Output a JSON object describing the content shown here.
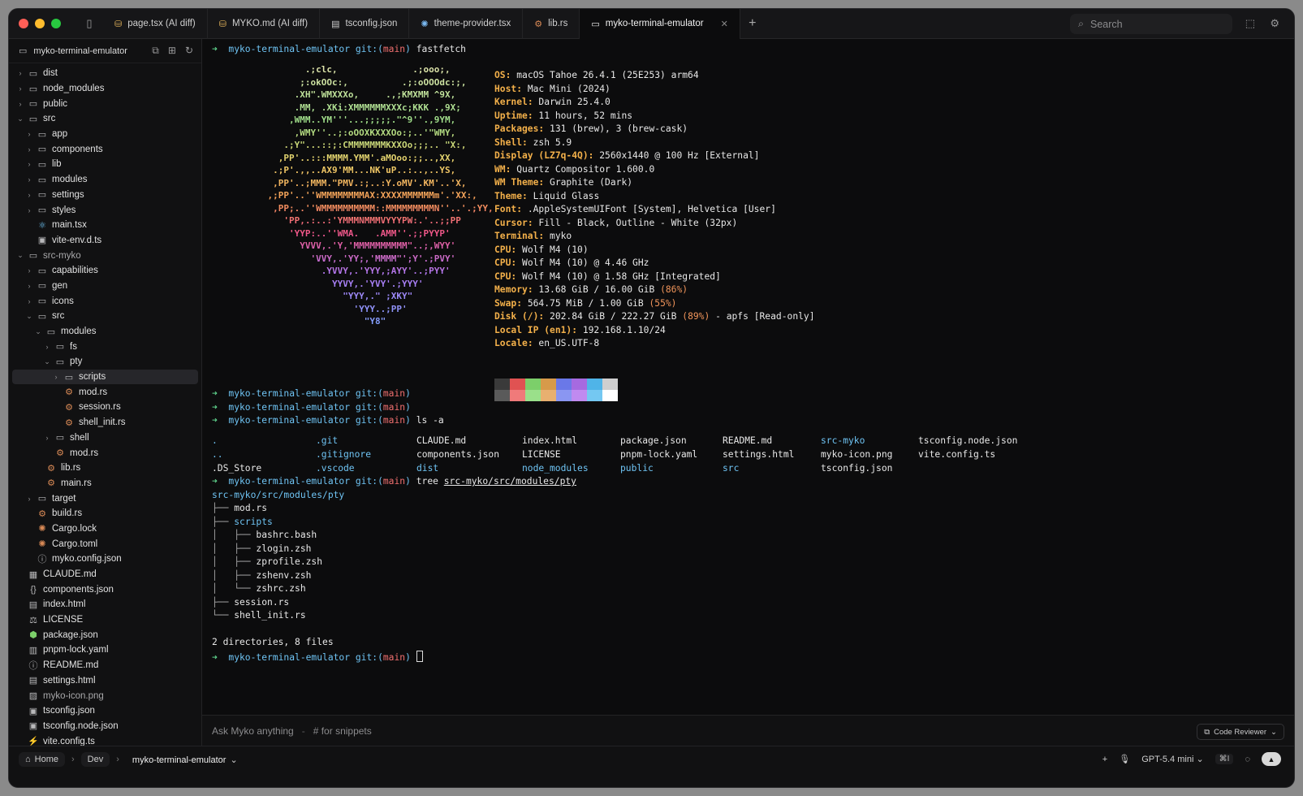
{
  "tabs": [
    {
      "label": "page.tsx (AI diff)",
      "icon": "folder-code-icon"
    },
    {
      "label": "MYKO.md (AI diff)",
      "icon": "folder-code-icon"
    },
    {
      "label": "tsconfig.json",
      "icon": "file-icon"
    },
    {
      "label": "theme-provider.tsx",
      "icon": "gear-icon"
    },
    {
      "label": "lib.rs",
      "icon": "rust-icon"
    },
    {
      "label": "myko-terminal-emulator",
      "icon": "folder-icon"
    }
  ],
  "search_label": "Search",
  "sidebar": {
    "project": "myko-terminal-emulator",
    "items": [
      {
        "label": "dist",
        "depth": 0,
        "chev": ">",
        "icon": "folder"
      },
      {
        "label": "node_modules",
        "depth": 0,
        "chev": ">",
        "icon": "folder"
      },
      {
        "label": "public",
        "depth": 0,
        "chev": ">",
        "icon": "folder"
      },
      {
        "label": "src",
        "depth": 0,
        "chev": "v",
        "icon": "folder"
      },
      {
        "label": "app",
        "depth": 1,
        "chev": ">",
        "icon": "folder"
      },
      {
        "label": "components",
        "depth": 1,
        "chev": ">",
        "icon": "folder"
      },
      {
        "label": "lib",
        "depth": 1,
        "chev": ">",
        "icon": "folder"
      },
      {
        "label": "modules",
        "depth": 1,
        "chev": ">",
        "icon": "folder"
      },
      {
        "label": "settings",
        "depth": 1,
        "chev": ">",
        "icon": "folder"
      },
      {
        "label": "styles",
        "depth": 1,
        "chev": ">",
        "icon": "folder"
      },
      {
        "label": "main.tsx",
        "depth": 1,
        "chev": "",
        "icon": "react"
      },
      {
        "label": "vite-env.d.ts",
        "depth": 1,
        "chev": "",
        "icon": "ts"
      },
      {
        "label": "src-myko",
        "depth": 0,
        "chev": "v",
        "icon": "folder",
        "dim": true
      },
      {
        "label": "capabilities",
        "depth": 1,
        "chev": ">",
        "icon": "folder"
      },
      {
        "label": "gen",
        "depth": 1,
        "chev": ">",
        "icon": "folder"
      },
      {
        "label": "icons",
        "depth": 1,
        "chev": ">",
        "icon": "folder"
      },
      {
        "label": "src",
        "depth": 1,
        "chev": "v",
        "icon": "folder"
      },
      {
        "label": "modules",
        "depth": 2,
        "chev": "v",
        "icon": "folder"
      },
      {
        "label": "fs",
        "depth": 3,
        "chev": ">",
        "icon": "folder"
      },
      {
        "label": "pty",
        "depth": 3,
        "chev": "v",
        "icon": "folder"
      },
      {
        "label": "scripts",
        "depth": 4,
        "chev": ">",
        "icon": "folder",
        "selected": true
      },
      {
        "label": "mod.rs",
        "depth": 4,
        "chev": "",
        "icon": "rust"
      },
      {
        "label": "session.rs",
        "depth": 4,
        "chev": "",
        "icon": "rust"
      },
      {
        "label": "shell_init.rs",
        "depth": 4,
        "chev": "",
        "icon": "rust"
      },
      {
        "label": "shell",
        "depth": 3,
        "chev": ">",
        "icon": "folder"
      },
      {
        "label": "mod.rs",
        "depth": 3,
        "chev": "",
        "icon": "rust"
      },
      {
        "label": "lib.rs",
        "depth": 2,
        "chev": "",
        "icon": "rust"
      },
      {
        "label": "main.rs",
        "depth": 2,
        "chev": "",
        "icon": "rust"
      },
      {
        "label": "target",
        "depth": 1,
        "chev": ">",
        "icon": "folder"
      },
      {
        "label": "build.rs",
        "depth": 1,
        "chev": "",
        "icon": "rust"
      },
      {
        "label": "Cargo.lock",
        "depth": 1,
        "chev": "",
        "icon": "gear"
      },
      {
        "label": "Cargo.toml",
        "depth": 1,
        "chev": "",
        "icon": "gear"
      },
      {
        "label": "myko.config.json",
        "depth": 1,
        "chev": "",
        "icon": "info"
      },
      {
        "label": "CLAUDE.md",
        "depth": 0,
        "chev": "",
        "icon": "md"
      },
      {
        "label": "components.json",
        "depth": 0,
        "chev": "",
        "icon": "braces"
      },
      {
        "label": "index.html",
        "depth": 0,
        "chev": "",
        "icon": "html"
      },
      {
        "label": "LICENSE",
        "depth": 0,
        "chev": "",
        "icon": "scale"
      },
      {
        "label": "package.json",
        "depth": 0,
        "chev": "",
        "icon": "pkg"
      },
      {
        "label": "pnpm-lock.yaml",
        "depth": 0,
        "chev": "",
        "icon": "yaml"
      },
      {
        "label": "README.md",
        "depth": 0,
        "chev": "",
        "icon": "info"
      },
      {
        "label": "settings.html",
        "depth": 0,
        "chev": "",
        "icon": "html"
      },
      {
        "label": "myko-icon.png",
        "depth": 0,
        "chev": "",
        "icon": "image",
        "dim": true
      },
      {
        "label": "tsconfig.json",
        "depth": 0,
        "chev": "",
        "icon": "ts"
      },
      {
        "label": "tsconfig.node.json",
        "depth": 0,
        "chev": "",
        "icon": "ts"
      },
      {
        "label": "vite.config.ts",
        "depth": 0,
        "chev": "",
        "icon": "vite"
      }
    ]
  },
  "terminal": {
    "prompt_dir": "myko-terminal-emulator",
    "prompt_git": "git:(",
    "prompt_branch": "main",
    "prompt_close": ")",
    "cmd1": "fastfetch",
    "logo": "           .;clc,              .;ooo;,\n          ;:okOOc:,          .;:oOOOdc:;,\n         .XH\".WMXXXo,     .,;KMXMM ^9X,\n         .MM, .XKi:XMMMMMMXXXc;KKK .,9X;\n        ,WMM..YM'''...;;;;;.\"^9''.,9YM,\n         ,WMY''..;:oOOXKXXXOo:;..'\"WMY,\n       .;Y\"...::;:CMMMMMMMKXXOo;;;.. \"X:,\n      ,PP'..:::MMMM.YMM'.aMOoo:;;..,XX,\n     .;P'.,,..AX9'MM...NK'uP..:..,..YS,\n     ,PP'..;MMM.\"PMV.:;..:Y.oMV'.KM'..'X,\n    ,;PP'..''WMMMMMMMMAX:XXXXMMMMMMm'.'XX:,\n     ,PP;..''WMMMMMMMMMM::MMMMMMMMMN''..'.;YY,\n       'PP,.:..:'YMMMNMMMVYYYPW:.'..;;PP\n        'YYP:..''WMA.   .AMM''.;;PYYP'\n          YVVV,.'Y,'MMMMMMMMMM\"..;,WYY'\n            'VVY,.'YY;,'MMMM\"';Y'.;PVY'\n              .YVVY,.'YYY,;AYY'..;PYY'\n                YYVY,.'YVY'.;YYY'\n                  \"YYY,.\" ;XKY\"\n                    'YYY..;PP'\n                      \"Y8\"",
    "info": [
      {
        "k": "OS",
        "v": "macOS Tahoe 26.4.1 (25E253) arm64"
      },
      {
        "k": "Host",
        "v": "Mac Mini (2024)"
      },
      {
        "k": "Kernel",
        "v": "Darwin 25.4.0"
      },
      {
        "k": "Uptime",
        "v": "11 hours, 52 mins"
      },
      {
        "k": "Packages",
        "v": "131 (brew), 3 (brew-cask)"
      },
      {
        "k": "Shell",
        "v": "zsh 5.9"
      },
      {
        "k": "Display (LZ7q-4Q)",
        "v": "2560x1440 @ 100 Hz [External]"
      },
      {
        "k": "WM",
        "v": "Quartz Compositor 1.600.0"
      },
      {
        "k": "WM Theme",
        "v": "Graphite (Dark)"
      },
      {
        "k": "Theme",
        "v": "Liquid Glass"
      },
      {
        "k": "Font",
        "v": ".AppleSystemUIFont [System], Helvetica [User]"
      },
      {
        "k": "Cursor",
        "v": "Fill - Black, Outline - White (32px)"
      },
      {
        "k": "Terminal",
        "v": "myko"
      },
      {
        "k": "CPU",
        "v": "Wolf M4 (10)"
      },
      {
        "k": "CPU",
        "v": "Wolf M4 (10) @ 4.46 GHz"
      },
      {
        "k": "CPU",
        "v": "Wolf M4 (10) @ 1.58 GHz [Integrated]"
      },
      {
        "k": "Memory",
        "v": "13.68 GiB / 16.00 GiB",
        "pct": "(86%)"
      },
      {
        "k": "Swap",
        "v": "564.75 MiB / 1.00 GiB",
        "pct": "(55%)"
      },
      {
        "k": "Disk (/)",
        "v": "202.84 GiB / 222.27 GiB",
        "pct": "(89%)",
        "tail": " - apfs [Read-only]"
      },
      {
        "k": "Local IP (en1)",
        "v": "192.168.1.10/24"
      },
      {
        "k": "Locale",
        "v": "en_US.UTF-8"
      }
    ],
    "palette_top": [
      "#3a3a3a",
      "#e05252",
      "#7ccf6a",
      "#d79a4a",
      "#6a78e8",
      "#a66ae0",
      "#4fb4e8",
      "#cfcfcf"
    ],
    "palette_bottom": [
      "#5a5a5a",
      "#f07a7a",
      "#9ae08a",
      "#e8b070",
      "#8a96f2",
      "#c08af0",
      "#74c8f2",
      "#ffffff"
    ],
    "cmd_ls": "ls -a",
    "ls_rows": [
      [
        ".",
        ".git",
        "CLAUDE.md",
        "index.html",
        "package.json",
        "README.md",
        "src-myko",
        "tsconfig.node.json"
      ],
      [
        "..",
        ".gitignore",
        "components.json",
        "LICENSE",
        "pnpm-lock.yaml",
        "settings.html",
        "myko-icon.png",
        "vite.config.ts"
      ],
      [
        ".DS_Store",
        ".vscode",
        "dist",
        "node_modules",
        "public",
        "src",
        "tsconfig.json",
        ""
      ]
    ],
    "ls_blue": [
      ".",
      "..",
      ".git",
      ".gitignore",
      ".vscode",
      "dist",
      "node_modules",
      "public",
      "src",
      "src-myko"
    ],
    "cmd_tree": "tree",
    "tree_arg": "src-myko/src/modules/pty",
    "tree_root": "src-myko/src/modules/pty",
    "tree_lines": [
      {
        "prefix": "├── ",
        "name": "mod.rs"
      },
      {
        "prefix": "├── ",
        "name": "scripts",
        "dir": true
      },
      {
        "prefix": "│   ├── ",
        "name": "bashrc.bash"
      },
      {
        "prefix": "│   ├── ",
        "name": "zlogin.zsh"
      },
      {
        "prefix": "│   ├── ",
        "name": "zprofile.zsh"
      },
      {
        "prefix": "│   ├── ",
        "name": "zshenv.zsh"
      },
      {
        "prefix": "│   └── ",
        "name": "zshrc.zsh"
      },
      {
        "prefix": "├── ",
        "name": "session.rs"
      },
      {
        "prefix": "└── ",
        "name": "shell_init.rs"
      }
    ],
    "tree_summary": "2 directories, 8 files"
  },
  "askbar": {
    "placeholder": "Ask Myko anything",
    "sep": "-",
    "hint": "# for snippets",
    "reviewer": "Code Reviewer"
  },
  "statusbar": {
    "home": "Home",
    "dev": "Dev",
    "project": "myko-terminal-emulator",
    "model": "GPT-5.4 mini",
    "shortcut": "⌘I"
  }
}
